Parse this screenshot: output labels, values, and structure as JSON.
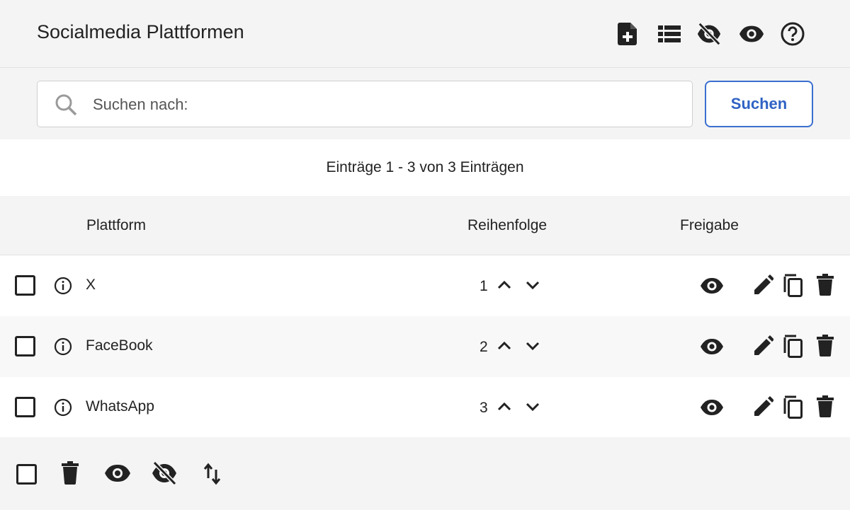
{
  "header": {
    "title": "Socialmedia Plattformen",
    "icons": [
      "add-document-icon",
      "list-icon",
      "eye-off-icon",
      "eye-icon",
      "help-icon"
    ]
  },
  "search": {
    "placeholder": "Suchen nach:",
    "value": "",
    "button_label": "Suchen"
  },
  "summary": "Einträge 1 - 3 von 3 Einträgen",
  "table": {
    "columns": [
      "Plattform",
      "Reihenfolge",
      "Freigabe"
    ],
    "rows": [
      {
        "name": "X",
        "order": "1",
        "visible": true
      },
      {
        "name": "FaceBook",
        "order": "2",
        "visible": true
      },
      {
        "name": "WhatsApp",
        "order": "3",
        "visible": true
      }
    ]
  },
  "footer": {
    "icons": [
      "select-all-checkbox",
      "trash-icon",
      "eye-icon",
      "eye-off-icon",
      "sort-icon"
    ]
  },
  "colors": {
    "accent": "#2f62c4",
    "icon": "#222222",
    "header_bg": "#f4f4f4"
  }
}
